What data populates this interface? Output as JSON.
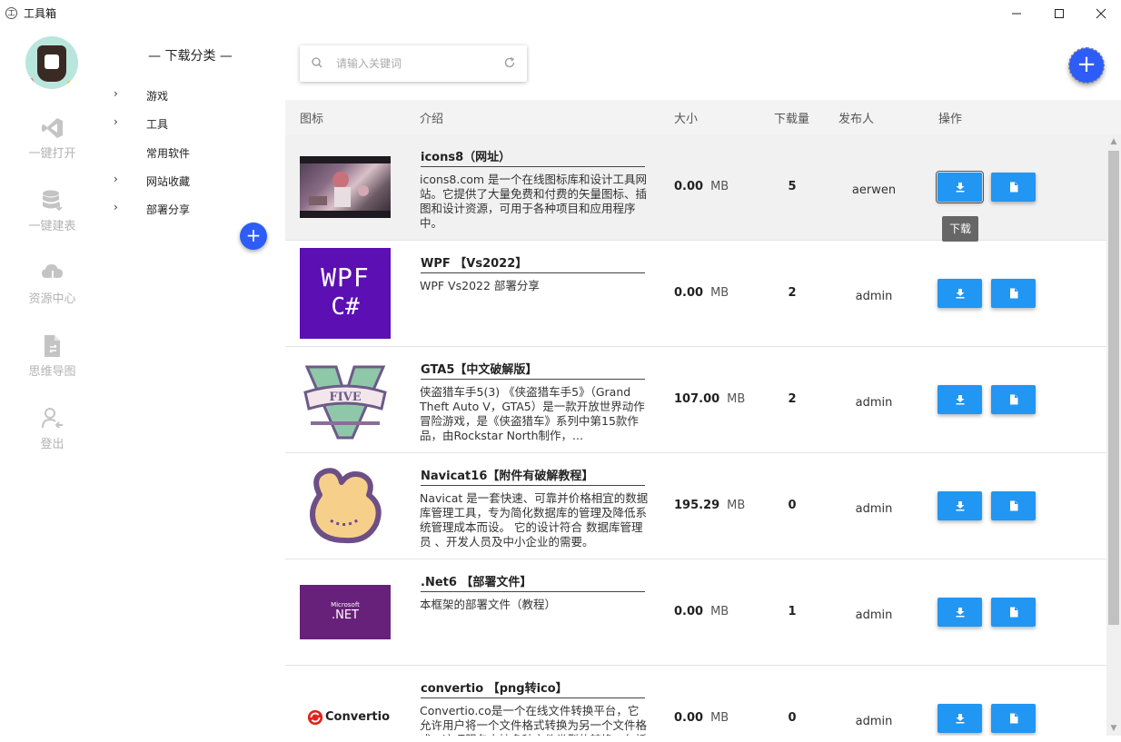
{
  "window": {
    "title": "工具箱"
  },
  "nav": {
    "items": [
      {
        "label": "一键打开",
        "icon": "vscode-icon"
      },
      {
        "label": "一键建表",
        "icon": "database-icon"
      },
      {
        "label": "资源中心",
        "icon": "cloud-download-icon"
      },
      {
        "label": "思维导图",
        "icon": "file-sync-icon"
      },
      {
        "label": "登出",
        "icon": "logout-user-icon"
      }
    ]
  },
  "categories": {
    "title": "— 下载分类 —",
    "items": [
      {
        "label": "游戏",
        "expandable": true
      },
      {
        "label": "工具",
        "expandable": true
      },
      {
        "label": "常用软件",
        "expandable": false
      },
      {
        "label": "网站收藏",
        "expandable": true
      },
      {
        "label": "部署分享",
        "expandable": true
      }
    ],
    "add_label": "+"
  },
  "search": {
    "placeholder": "请输入关键词",
    "value": ""
  },
  "add_button": "+",
  "table": {
    "headers": [
      "图标",
      "介绍",
      "大小",
      "下载量",
      "发布人",
      "操作"
    ],
    "rows": [
      {
        "name": "icons8（网址）",
        "desc": "icons8.com 是一个在线图标库和设计工具网站。它提供了大量免费和付费的矢量图标、插图和设计资源，可用于各种项目和应用程序中。",
        "size": "0.00",
        "unit": "MB",
        "downloads": "5",
        "publisher": "aerwen"
      },
      {
        "name": "WPF 【Vs2022】",
        "desc": "WPF Vs2022 部署分享",
        "size": "0.00",
        "unit": "MB",
        "downloads": "2",
        "publisher": "admin"
      },
      {
        "name": "GTA5【中文破解版】",
        "desc": "侠盗猎车手5(3) 《侠盗猎车手5》（Grand Theft Auto V，GTA5）是一款开放世界动作冒险游戏，是《侠盗猎车》系列中第15款作品，由Rockstar North制作，...",
        "size": "107.00",
        "unit": "MB",
        "downloads": "2",
        "publisher": "admin"
      },
      {
        "name": "Navicat16【附件有破解教程】",
        "desc": "Navicat 是一套快速、可靠并价格相宜的数据库管理工具，专为简化数据库的管理及降低系统管理成本而设。 它的设计符合 数据库管理员 、开发人员及中小企业的需要。",
        "size": "195.29",
        "unit": "MB",
        "downloads": "0",
        "publisher": "admin"
      },
      {
        "name": ".Net6 【部署文件】",
        "desc": "本框架的部署文件（教程）",
        "size": "0.00",
        "unit": "MB",
        "downloads": "1",
        "publisher": "admin"
      },
      {
        "name": "convertio 【png转ico】",
        "desc": "Convertio.co是一个在线文件转换平台，它允许用户将一个文件格式转换为另一个文件格式。这项服务支持多种文件类型的转换，包括",
        "size": "0.00",
        "unit": "MB",
        "downloads": "0",
        "publisher": "admin"
      }
    ],
    "thumb_text": {
      "wpf_line1": "WPF",
      "wpf_line2": "C#",
      "gta_word": "FIVE",
      "net_line1": "Microsoft",
      "net_line2": ".NET",
      "convertio": "Convertio"
    }
  },
  "tooltip": "下载",
  "colors": {
    "accent": "#2d5cf7",
    "action": "#2196f3",
    "wpf_bg": "#5c0fb3",
    "net_bg": "#68217a"
  }
}
